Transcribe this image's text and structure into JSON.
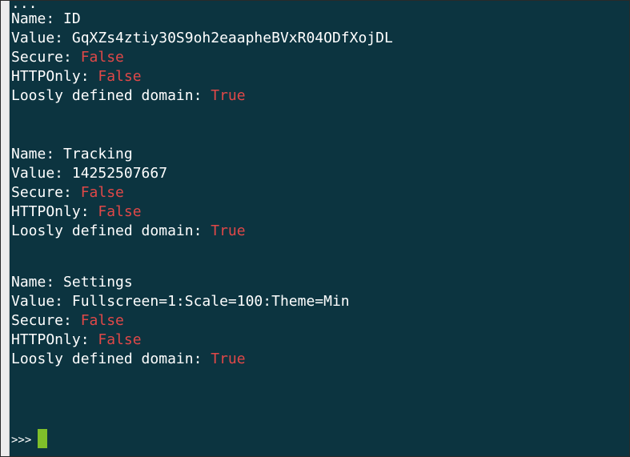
{
  "lines": {
    "ellipsis": "...",
    "c1_name": "Name: ID",
    "c1_value": "Value: GqXZs4ztiy30S9oh2eaapheBVxR04ODfXojDL",
    "c1_secure_label": "Secure: ",
    "c1_secure_val": "False",
    "c1_http_label": "HTTPOnly: ",
    "c1_http_val": "False",
    "c1_loose_label": "Loosly defined domain: ",
    "c1_loose_val": "True",
    "c2_name": "Name: Tracking",
    "c2_value": "Value: 14252507667",
    "c2_secure_label": "Secure: ",
    "c2_secure_val": "False",
    "c2_http_label": "HTTPOnly: ",
    "c2_http_val": "False",
    "c2_loose_label": "Loosly defined domain: ",
    "c2_loose_val": "True",
    "c3_name": "Name: Settings",
    "c3_value": "Value: Fullscreen=1:Scale=100:Theme=Min",
    "c3_secure_label": "Secure: ",
    "c3_secure_val": "False",
    "c3_http_label": "HTTPOnly: ",
    "c3_http_val": "False",
    "c3_loose_label": "Loosly defined domain: ",
    "c3_loose_val": "True",
    "prompt": ">>>"
  },
  "colors": {
    "background": "#0c3440",
    "text": "#ffffff",
    "flag": "#e04848",
    "cursor": "#7fbf2a"
  }
}
